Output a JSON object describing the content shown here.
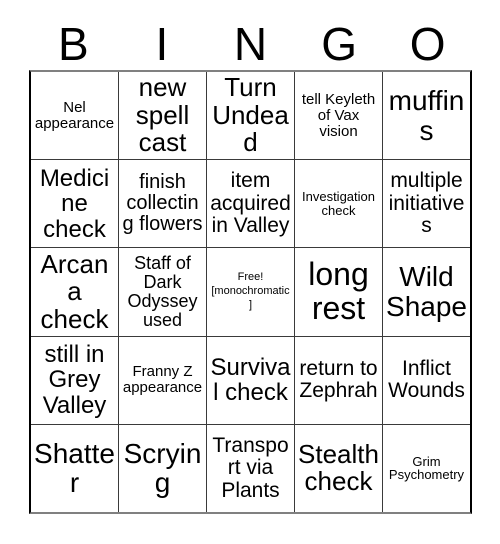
{
  "card": {
    "header_letters": [
      "B",
      "I",
      "N",
      "G",
      "O"
    ],
    "grid_columns": 5,
    "grid_rows": 5,
    "border_color": "#000000",
    "grid_line_color": "#3a3a3a",
    "background_color": "#ffffff",
    "text_color": "#000000",
    "rows": [
      [
        {
          "text": "Nel appearance",
          "size": "s"
        },
        {
          "text": "new spell cast",
          "size": "xxl"
        },
        {
          "text": "Turn Undead",
          "size": "xxl"
        },
        {
          "text": "tell Keyleth of Vax vision",
          "size": "s"
        },
        {
          "text": "muffins",
          "size": "xxl"
        }
      ],
      [
        {
          "text": "Medicine check",
          "size": "xl"
        },
        {
          "text": "finish collecting flowers",
          "size": "l"
        },
        {
          "text": "item acquired in Valley",
          "size": "xl"
        },
        {
          "text": "Investigation check",
          "size": "xs"
        },
        {
          "text": "multiple initiatives",
          "size": "l"
        }
      ],
      [
        {
          "text": "Arcana check",
          "size": "xxl"
        },
        {
          "text": "Staff of Dark Odyssey used",
          "size": "m"
        },
        {
          "text": "Free! [monochromatic]",
          "size": "free"
        },
        {
          "text": "long rest",
          "size": "xxxl"
        },
        {
          "text": "Wild Shape",
          "size": "xxl"
        }
      ],
      [
        {
          "text": "still in Grey Valley",
          "size": "xl"
        },
        {
          "text": "Franny Z appearance",
          "size": "s"
        },
        {
          "text": "Survival check",
          "size": "xl"
        },
        {
          "text": "return to Zephrah",
          "size": "l"
        },
        {
          "text": "Inflict Wounds",
          "size": "l"
        }
      ],
      [
        {
          "text": "Shatter",
          "size": "xxl"
        },
        {
          "text": "Scrying",
          "size": "xxl"
        },
        {
          "text": "Transport via Plants",
          "size": "l"
        },
        {
          "text": "Stealth check",
          "size": "xxl"
        },
        {
          "text": "Grim Psychometry",
          "size": "xs"
        }
      ]
    ]
  }
}
